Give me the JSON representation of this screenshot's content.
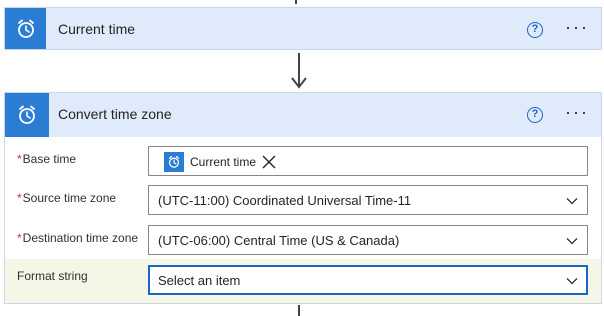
{
  "card_current_time": {
    "title": "Current time",
    "help": "?",
    "more": "···"
  },
  "card_convert": {
    "title": "Convert time zone",
    "help": "?",
    "more": "···",
    "fields": {
      "base_time": {
        "label": "Base time",
        "required_mark": "*",
        "token_label": "Current time"
      },
      "source_tz": {
        "label": "Source time zone",
        "required_mark": "*",
        "value": "(UTC-11:00) Coordinated Universal Time-11"
      },
      "destination_tz": {
        "label": "Destination time zone",
        "required_mark": "*",
        "value": "(UTC-06:00) Central Time (US & Canada)"
      },
      "format_string": {
        "label": "Format string",
        "placeholder": "Select an item"
      }
    }
  },
  "colors": {
    "accent": "#2b7cd3",
    "header_bg": "#dfebfa",
    "link_blue": "#1c64c8",
    "required_red": "#c4314b",
    "highlight_row": "#f5f6e6"
  },
  "icons": {
    "card_icon": "alarm-clock-icon",
    "help": "help-circle-icon",
    "more": "more-options-icon",
    "remove_token": "close-icon",
    "dropdown": "chevron-down-icon"
  }
}
